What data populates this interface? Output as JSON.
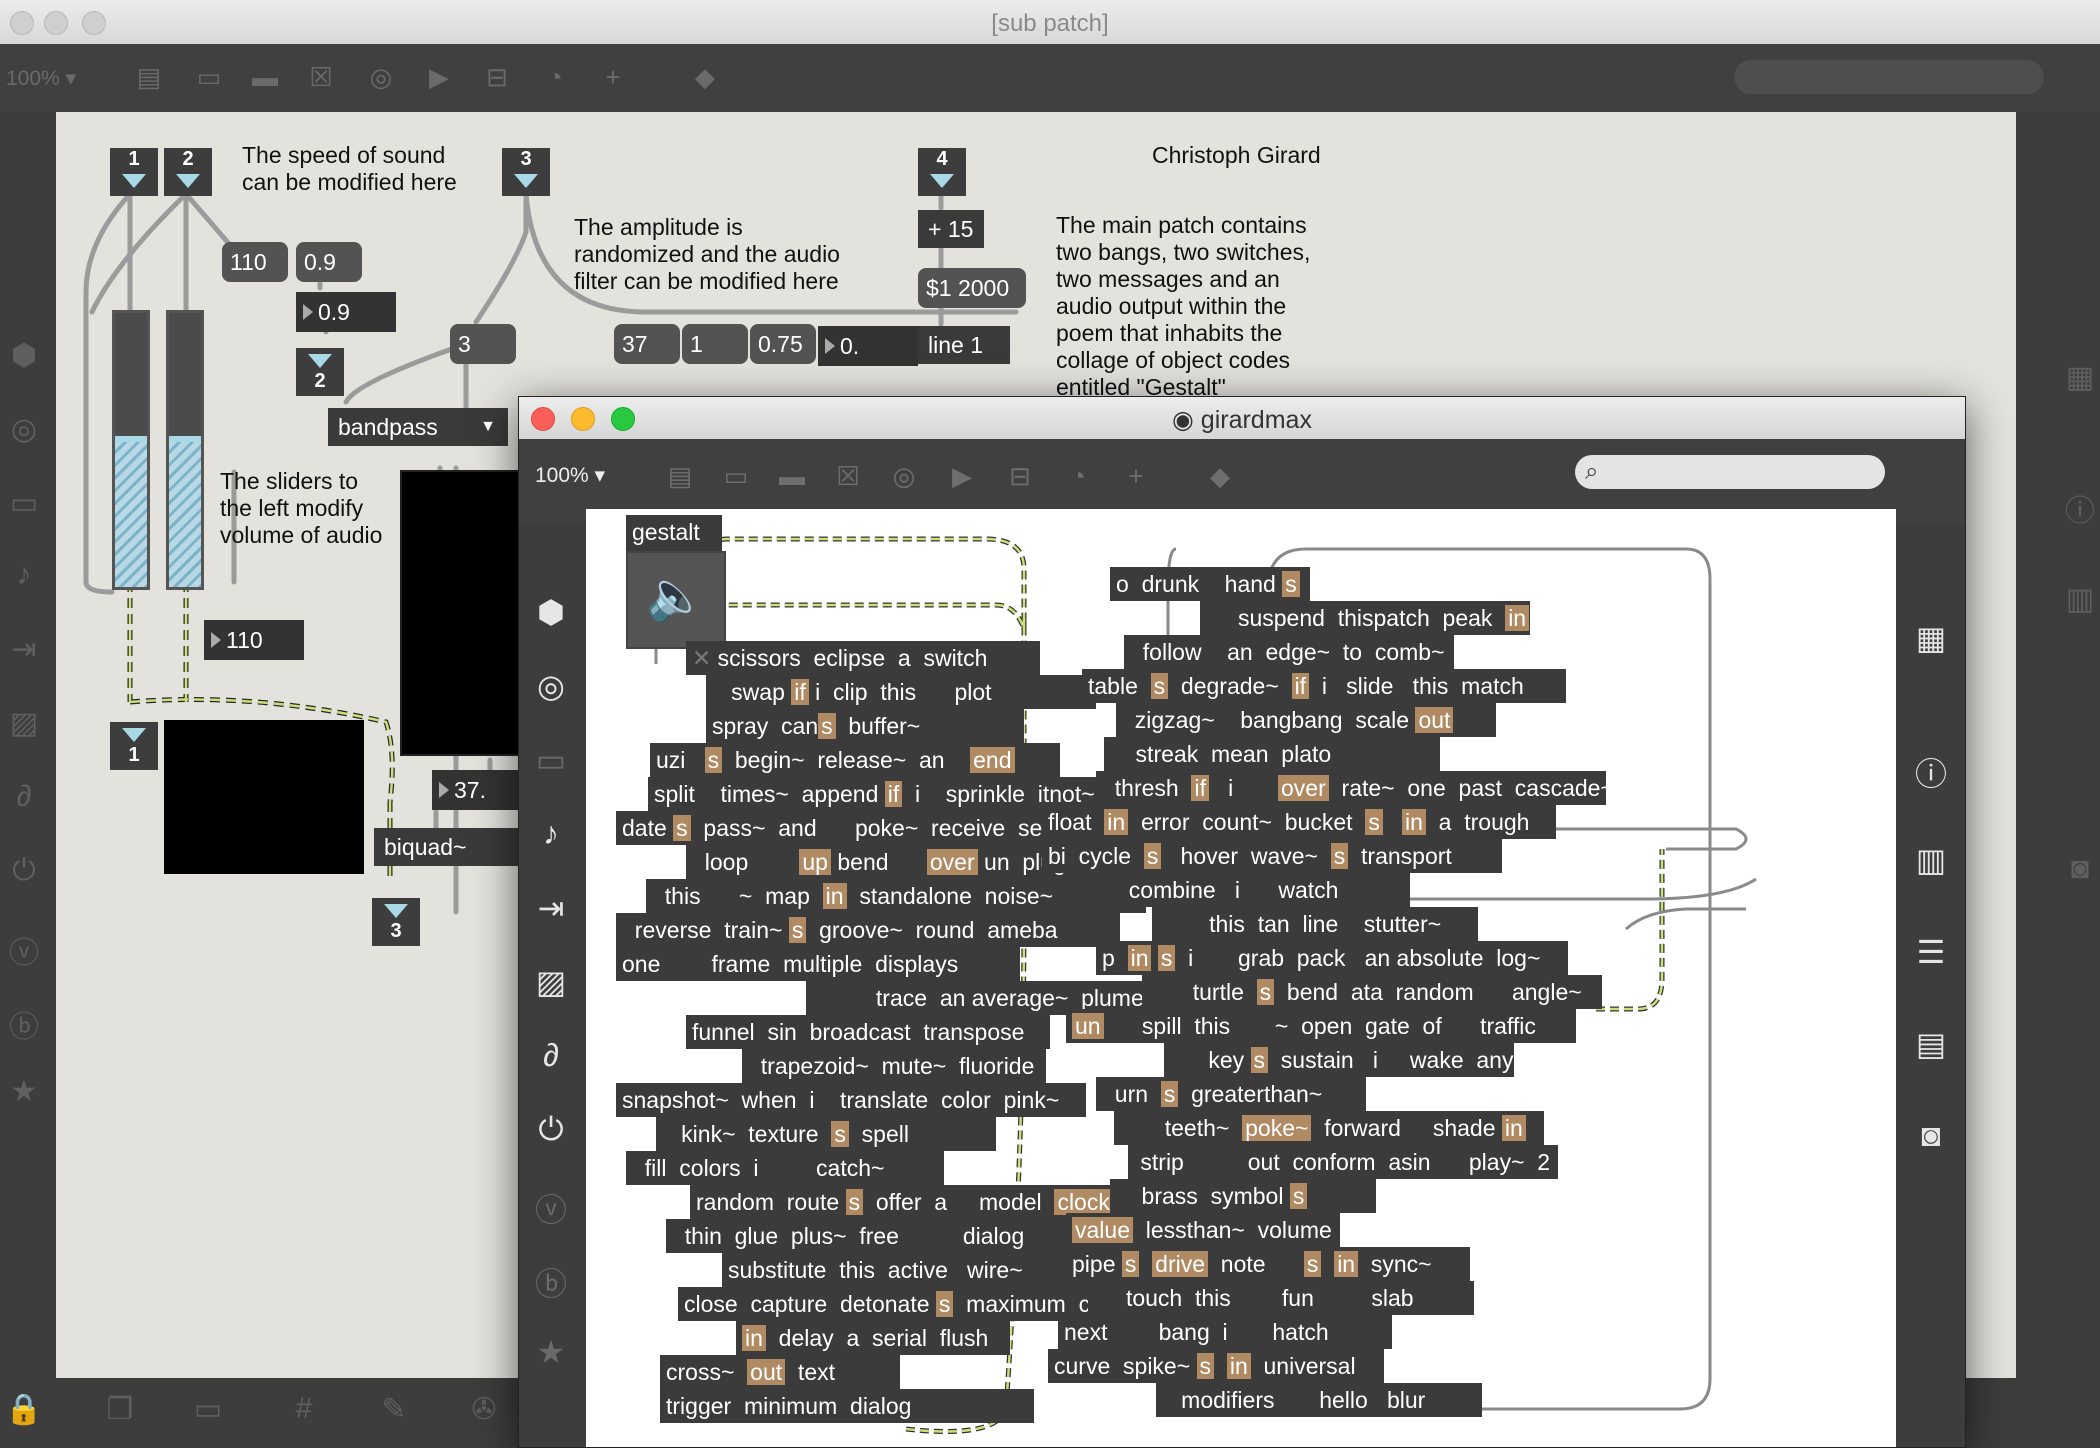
{
  "back_window": {
    "title": "[sub patch]",
    "zoom": "100% ▾",
    "comments": {
      "speed": "The speed of sound\ncan be modified here",
      "amplitude": "The amplitude is\nrandomized and the audio\nfilter can be modified here",
      "author": "Christoph Girard",
      "main_patch": "The main patch contains\ntwo bangs, two switches,\ntwo messages and an\naudio output within the\npoem that inhabits the\ncollage of object codes\nentitled \"Gestalt\"",
      "sliders": "The sliders to\nthe left modify\nvolume of audio"
    },
    "inlets": [
      "1",
      "2",
      "3",
      "4"
    ],
    "outlets": [
      "1",
      "2",
      "3"
    ],
    "messages": {
      "m110": "110",
      "m09": "0.9",
      "m3": "3",
      "m37": "37",
      "m1": "1",
      "m075": "0.75",
      "m1000": "$1 2000"
    },
    "numbers": {
      "n09": "0.9",
      "n0": "0.",
      "n110": "110",
      "n37": "37."
    },
    "objects": {
      "plus15": "+ 15",
      "line1": "line 1",
      "bandpass": "bandpass",
      "biquad": "biquad~"
    },
    "sliders": [
      0.53,
      0.53
    ]
  },
  "front_window": {
    "title": "girardmax",
    "zoom": "100% ▾",
    "search_placeholder": "",
    "gestalt_label": "gestalt"
  },
  "colors": {
    "accent": "#b08a63",
    "inlet_arrow": "#a9d9e6",
    "dark_box": "#3b3b3b"
  }
}
